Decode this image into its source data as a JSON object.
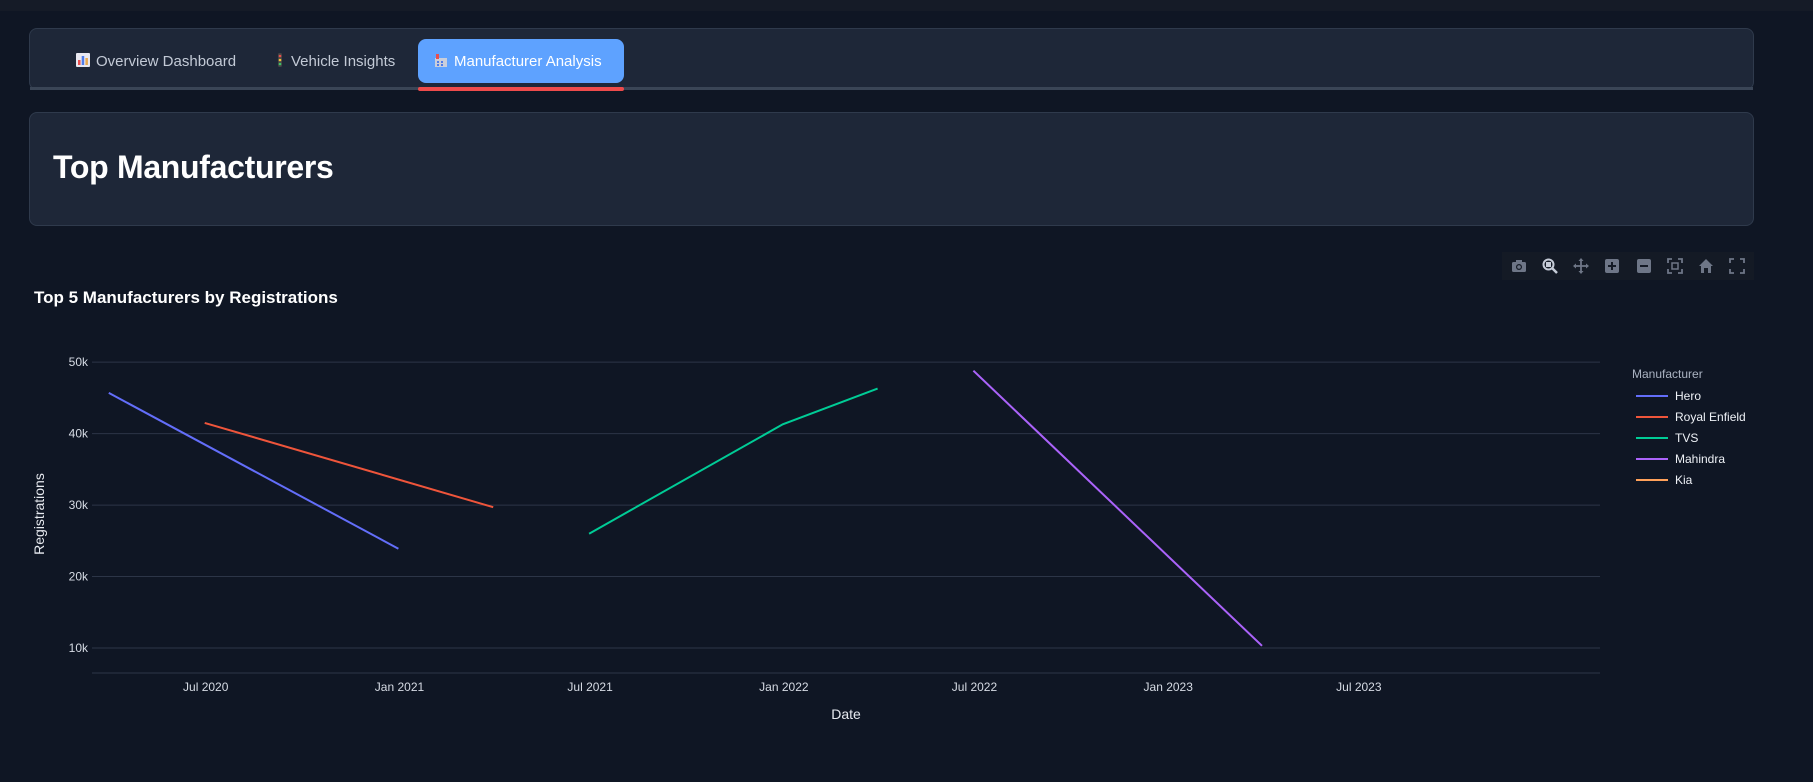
{
  "tabs": [
    {
      "label": "Overview Dashboard",
      "icon": "bar-chart-icon",
      "active": false
    },
    {
      "label": "Vehicle Insights",
      "icon": "traffic-light-icon",
      "active": false
    },
    {
      "label": "Manufacturer Analysis",
      "icon": "factory-icon",
      "active": true
    }
  ],
  "page": {
    "heading": "Top Manufacturers"
  },
  "modebar": [
    "camera-icon",
    "zoom-icon",
    "pan-icon",
    "zoom-in-icon",
    "zoom-out-icon",
    "autoscale-icon",
    "reset-axes-icon",
    "fullscreen-icon"
  ],
  "colors": {
    "accent": "#5ea2ff",
    "active_underline": "#ee4b4b",
    "background": "#0f1624",
    "card": "#1e2738"
  },
  "chart_data": {
    "type": "line",
    "title": "Top 5 Manufacturers by Registrations",
    "xlabel": "Date",
    "ylabel": "Registrations",
    "x_ticks": [
      "Jul 2020",
      "Jan 2021",
      "Jul 2021",
      "Jan 2022",
      "Jul 2022",
      "Jan 2023",
      "Jul 2023"
    ],
    "y_ticks": [
      "10k",
      "20k",
      "30k",
      "40k",
      "50k"
    ],
    "xlim": [
      "2020-03-15",
      "2024-02-15"
    ],
    "ylim": [
      6500,
      51000
    ],
    "grid": true,
    "legend_title": "Manufacturer",
    "legend_position": "right",
    "series": [
      {
        "name": "Hero",
        "color": "#636efa",
        "points": [
          [
            "2020-03-31",
            45700
          ],
          [
            "2020-12-31",
            23900
          ]
        ]
      },
      {
        "name": "Royal Enfield",
        "color": "#ef553b",
        "points": [
          [
            "2020-06-30",
            41500
          ],
          [
            "2021-03-31",
            29700
          ]
        ]
      },
      {
        "name": "TVS",
        "color": "#00cc96",
        "points": [
          [
            "2021-06-30",
            26000
          ],
          [
            "2021-12-31",
            41300
          ],
          [
            "2022-03-31",
            46300
          ]
        ]
      },
      {
        "name": "Mahindra",
        "color": "#ab63fa",
        "points": [
          [
            "2022-06-30",
            48800
          ],
          [
            "2023-03-31",
            10300
          ]
        ]
      },
      {
        "name": "Kia",
        "color": "#ffa15a",
        "points": []
      }
    ]
  }
}
